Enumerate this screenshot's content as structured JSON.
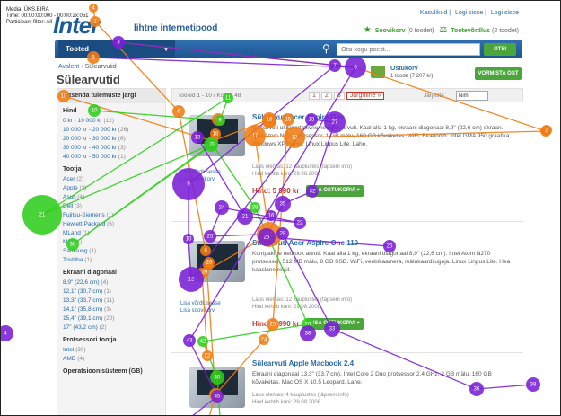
{
  "meta": {
    "line1": "Media: ÜKS.BIRA",
    "line2": "Time: 00:00:00:000 - 00:00:2x:051",
    "line3": "Participant filter: All"
  },
  "header": {
    "logo": "Inter",
    "tagline": "lihtne internetipood",
    "top_links": [
      "Kasulikud",
      "Logi sisse",
      "Logi sisse"
    ],
    "wishlist_label": "Soovikorv",
    "wishlist_count": "(0 toodet)",
    "compare_label": "Tootevõrdlus",
    "compare_count": "(2 toodet)"
  },
  "nav": {
    "category_label": "Tooted",
    "search_placeholder": "Otsi kogu poest...",
    "search_button": "OTSI"
  },
  "breadcrumb": {
    "home": "Avaleht",
    "current": "Sülearvutid"
  },
  "page_title": "Sülearvutid",
  "cart": {
    "title": "Ostukorv",
    "subtitle": "1 toode (7 207 kr)",
    "checkout_button": "VORMISTA OST"
  },
  "sidebar": {
    "header": "Kitsenda tulemuste järgi",
    "sections": [
      {
        "title": "Hind",
        "items": [
          {
            "label": "0 kr - 10 000 kr",
            "count": "(12)"
          },
          {
            "label": "10 000 kr - 20 000 kr",
            "count": "(26)"
          },
          {
            "label": "20 000 kr - 30 000 kr",
            "count": "(6)"
          },
          {
            "label": "30 000 kr - 40 000 kr",
            "count": "(3)"
          },
          {
            "label": "40 000 kr - 50 000 kr",
            "count": "(1)"
          }
        ]
      },
      {
        "title": "Tootja",
        "items": [
          {
            "label": "Acer",
            "count": "(2)"
          },
          {
            "label": "Apple",
            "count": "(3)"
          },
          {
            "label": "Asus",
            "count": "(4)"
          },
          {
            "label": "Dell",
            "count": "(3)"
          },
          {
            "label": "Fujitsu-Siemens",
            "count": "(1)"
          },
          {
            "label": "Hewlett Packard",
            "count": "(6)"
          },
          {
            "label": "MLand",
            "count": "(1)"
          },
          {
            "label": "MSI",
            "count": "(1)"
          },
          {
            "label": "Samsung",
            "count": "(1)"
          },
          {
            "label": "Toshiba",
            "count": "(1)"
          }
        ]
      },
      {
        "title": "Ekraani diagonaal",
        "items": [
          {
            "label": "8,9\" (22,6 cm)",
            "count": "(4)"
          },
          {
            "label": "12,1\" (30,7 cm)",
            "count": "(1)"
          },
          {
            "label": "13,3\" (33,7 cm)",
            "count": "(11)"
          },
          {
            "label": "14,1\" (35,8 cm)",
            "count": "(3)"
          },
          {
            "label": "15,4\" (39,1 cm)",
            "count": "(20)"
          },
          {
            "label": "17\" (43,2 cm)",
            "count": "(2)"
          }
        ]
      },
      {
        "title": "Protsessori tootja",
        "items": [
          {
            "label": "Intel",
            "count": "(30)"
          },
          {
            "label": "AMD",
            "count": "(4)"
          }
        ]
      },
      {
        "title": "Operatsioonisüsteem (GB)",
        "items": []
      }
    ]
  },
  "results": {
    "count": "Tooted 1 - 10 / Kokku 48",
    "pages": [
      "1",
      "2",
      "3"
    ],
    "next": "Järgmine »",
    "sort_label": "Järjesta",
    "sort_value": "Nimi"
  },
  "products": [
    {
      "title": "Sülearvuti Acer Aspire One",
      "desc": "Sülearvuti ultraportatiivne netbook arvuti. Kaal alla 1 kg, ekraani diagonaal 8,9\" (22,6 cm) ekraan. Intel Atom N270 protsessor, 1 GB mälu, 160 GB kõvaketas, WiFi, Bluetooth. Intel GMA 950 graafika, Windows XP Home. Linux Linpus Lite. Lahe.",
      "meta1": "Laos olemas: 12 kauplustes (täpsem info)",
      "meta2": "Hind kehtib kuni: 29.08.2008",
      "price": "Hind: 5 990 kr",
      "add_button": "LISA OSTUKORVI +",
      "compare_1": "Lisa võrdlusesse",
      "compare_2": "Lisa soovikorvi"
    },
    {
      "title": "Sülearvuti Acer Aspire One 110",
      "desc": "Kompaktne netbook arvuti. Kaal alla 1 kg, ekraani diagonaal 8,9\" (22,6 cm). Intel Atom N270 protsessor, 512 MB mälu, 8 GB SSD. WiFi, veebikaamera, mälukaardilugeja. Linux Linpus Lite. Hea kaaslane reisil.",
      "meta1": "Laos olemas: 12 kauplustes (täpsem info)",
      "meta2": "Hind kehtib kuni: 29.08.2008",
      "price": "Hind: 4 990 kr",
      "add_button": "LISA OSTUKORVI +",
      "compare_1": "Lisa võrdlusesse",
      "compare_2": "Lisa soovikorvi"
    },
    {
      "title": "Sülearvuti Apple Macbook 2.4",
      "desc": "Ekraani diagonaal 13,3\" (33,7 cm). Intel Core 2 Duo protsessor 2,4 GHz, 2 GB mälu, 160 GB kõvaketas. Mac OS X 10.5 Leopard. Lahe.",
      "meta1": "Laos olemas: 4 kauplustes (täpsem info)",
      "meta2": "Hind kehtib kuni: 29.08.2008",
      "price": "",
      "add_button": "",
      "compare_1": "",
      "compare_2": ""
    }
  ],
  "gaze": {
    "colors": {
      "orange": "#f07c12",
      "green": "#2fce1d",
      "purple": "#7a1fd6"
    }
  }
}
